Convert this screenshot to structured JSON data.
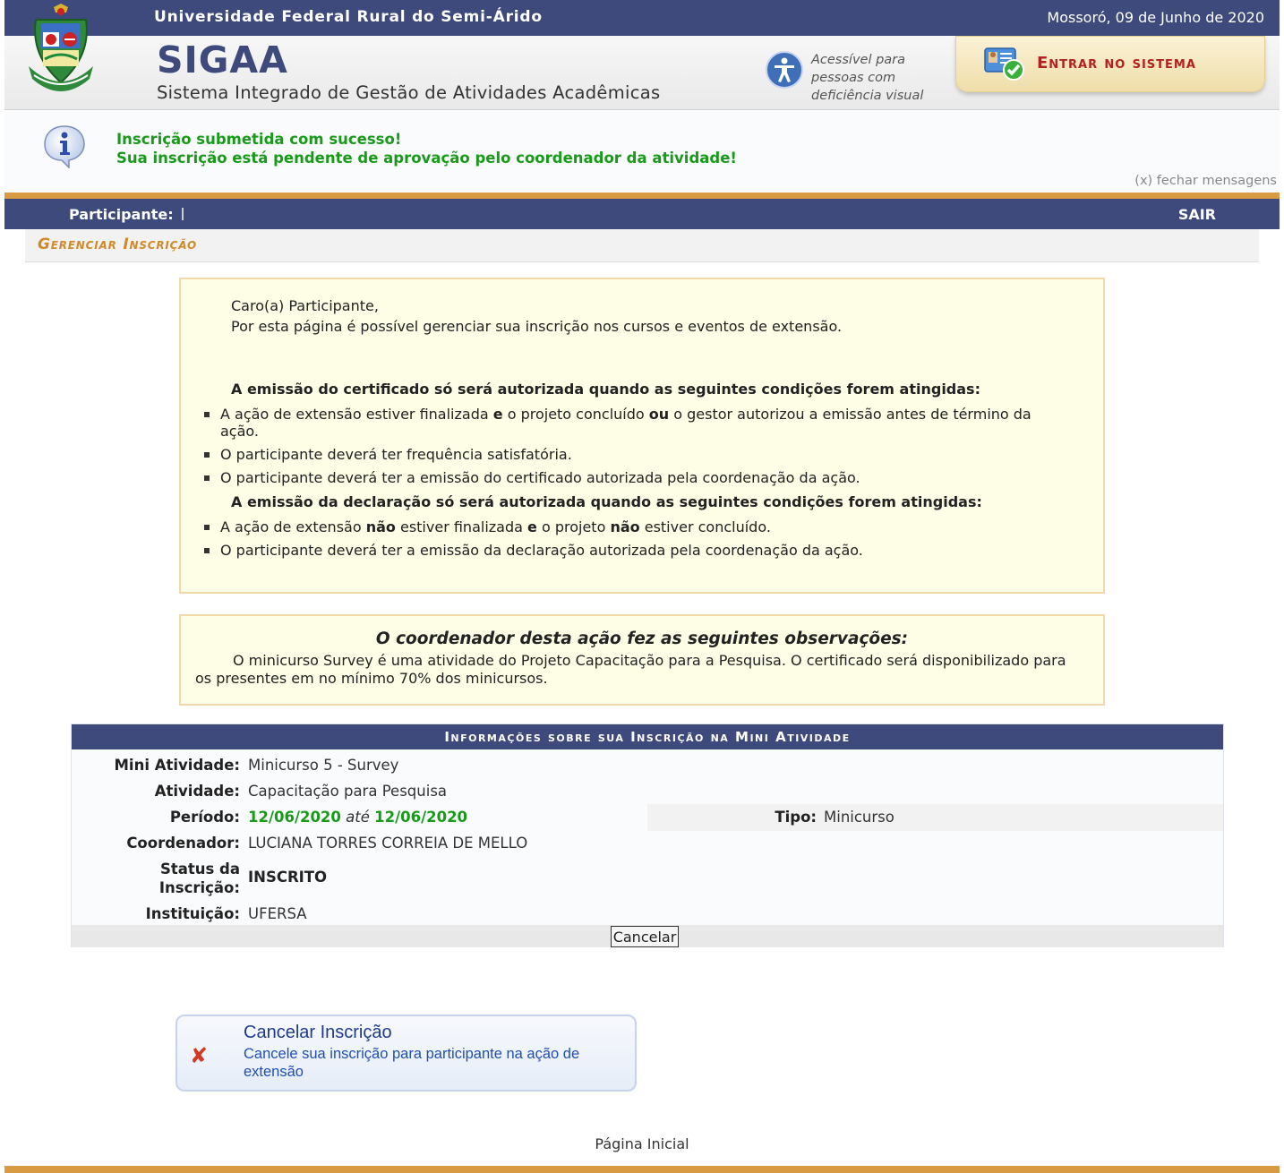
{
  "header": {
    "university": "Universidade Federal Rural do Semi-Árido",
    "date": "Mossoró, 09 de Junho de 2020",
    "app_name": "SIGAA",
    "app_subtitle": "Sistema Integrado de Gestão de Atividades Acadêmicas",
    "accessibility_lines": [
      "Acessível para",
      "pessoas com",
      "deficiência visual"
    ],
    "login_label": "Entrar no sistema"
  },
  "message": {
    "line1": "Inscrição submetida com sucesso!",
    "line2": "Sua inscrição está pendente de aprovação pelo coordenador da atividade!",
    "close": "(x) fechar mensagens"
  },
  "participant_bar": {
    "label": "Participante:",
    "exit": "SAIR"
  },
  "page_title": "Gerenciar Inscrição",
  "description": {
    "greeting": "Caro(a) Participante,",
    "intro": "Por esta página é possível gerenciar sua inscrição nos cursos e eventos de extensão.",
    "cert_heading": "A emissão do certificado só será autorizada quando as seguintes condições forem atingidas:",
    "cert_items": [
      {
        "parts": [
          "A ação de extensão estiver finalizada ",
          "e",
          " o projeto concluído ",
          "ou",
          " o gestor autorizou a emissão antes de término da"
        ],
        "cont": "ação."
      },
      {
        "text": "O participante deverá ter frequência satisfatória."
      },
      {
        "text": "O participante deverá ter a emissão do certificado autorizada pela coordenação da ação."
      }
    ],
    "decl_heading": "A emissão da declaração só será autorizada quando as seguintes condições forem atingidas:",
    "decl_items": [
      {
        "parts": [
          "A ação de extensão ",
          "não",
          " estiver finalizada ",
          "e",
          " o projeto ",
          "não",
          " estiver concluído."
        ]
      },
      {
        "text": "O participante deverá ter a emissão da declaração autorizada pela coordenação da ação."
      }
    ]
  },
  "observations": {
    "title": "O coordenador desta ação fez as seguintes observações:",
    "text": "O minicurso Survey é uma atividade do Projeto Capacitação para a Pesquisa. O certificado será disponibilizado para os presentes em no mínimo 70% dos minicursos."
  },
  "info": {
    "header": "Informações sobre sua Inscrição na Mini Atividade",
    "mini_atividade_label": "Mini Atividade:",
    "mini_atividade": "Minicurso 5 - Survey",
    "atividade_label": "Atividade:",
    "atividade": "Capacitação para Pesquisa",
    "periodo_label": "Período:",
    "periodo_inicio": "12/06/2020",
    "periodo_sep": "até",
    "periodo_fim": "12/06/2020",
    "tipo_label": "Tipo:",
    "tipo": "Minicurso",
    "coordenador_label": "Coordenador:",
    "coordenador": "LUCIANA TORRES CORREIA DE MELLO",
    "status_label_1": "Status da",
    "status_label_2": "Inscrição:",
    "status": "INSCRITO",
    "instituicao_label": "Instituição:",
    "instituicao": "UFERSA",
    "cancel_button": "Cancelar"
  },
  "cancel_card": {
    "title": "Cancelar Inscrição",
    "desc": "Cancele sua inscrição para participante na ação de extensão"
  },
  "footer": {
    "home": "Página Inicial"
  }
}
